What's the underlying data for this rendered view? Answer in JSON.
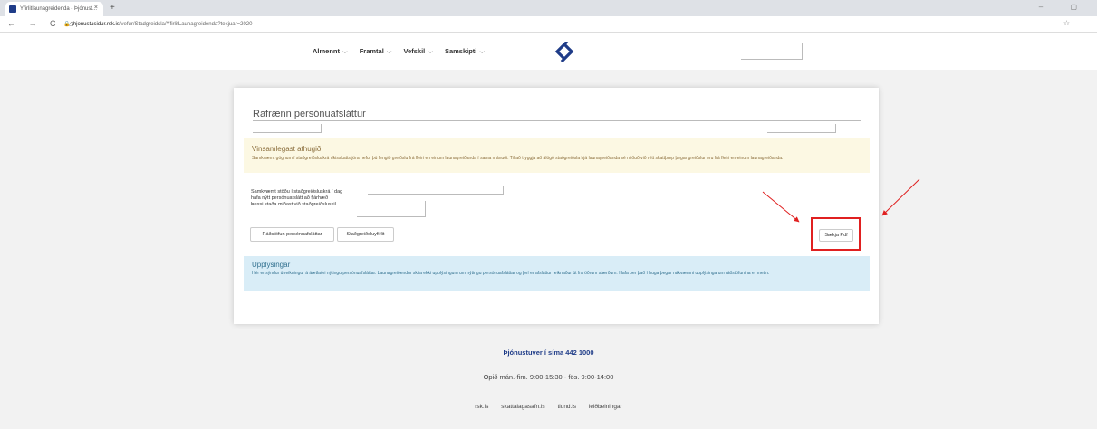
{
  "browser": {
    "tab_title": "Yfirlitlaunagreidenda - Þjónust...",
    "tab_close": "×",
    "new_tab": "+",
    "window_controls": "–  ▢",
    "nav_buttons": "← → C ⌂",
    "url_host": "thjonustusidur.rsk.is",
    "url_path": "/vefur/Stadgreidsla/YfirlitLaunagreidenda?tekjuar=2020",
    "lock_glyph": "🔒",
    "star": "☆"
  },
  "header": {
    "menu": [
      {
        "label": "Almennt"
      },
      {
        "label": "Framtal"
      },
      {
        "label": "Vefskil"
      },
      {
        "label": "Samskipti"
      }
    ],
    "chevron": "⌵",
    "brand_color": "#1f3c88"
  },
  "card": {
    "title": "Rafrænn persónuafsláttur",
    "warning": {
      "heading": "Vinsamlegast athugið",
      "text": "Samkvæmt gögnum í staðgreiðsluskrá ríkisskattstjóra hefur þú fengið greiðslu frá fleiri en einum launagreiðanda í sama mánuði. Til að tryggja að álögð staðgreiðsla hjá launagreiðanda sé miðuð við rétt skattþrep þegar greiðslur eru frá fleiri en einum launagreiðanda."
    },
    "status_lines": [
      "Samkvæmt stöðu í staðgreiðsluskrá í dag",
      "hafa nýtt persónuafslátt að fjárhæð",
      "Þessi staða miðast við staðgreiðsluskil"
    ],
    "buttons": {
      "allocation": "Ráðstöfun persónuafsláttar",
      "withholding": "Staðgreiðsluyfirlit",
      "pdf": "Sækja Pdf"
    },
    "info": {
      "heading": "Upplýsingar",
      "text": "Hér er sýndur útreikningur á áætlaðri nýtingu persónuafsláttar. Launagreiðendur skila ekki upplýsingum um nýtingu persónuafsláttar og því er afsláttur reiknaður út frá öðrum stærðum. Hafa ber það í huga þegar nákvæmni upplýsinga um ráðstöfunina er metin."
    }
  },
  "footer": {
    "phone": "Þjónustuver í síma 442 1000",
    "hours": "Opið mán.-fim. 9:00-15:30 - fös. 9:00-14:00",
    "links": [
      "rsk.is",
      "skattalagasafn.is",
      "tiund.is",
      "leiðbeiningar"
    ]
  },
  "annotation_color": "#e02020"
}
